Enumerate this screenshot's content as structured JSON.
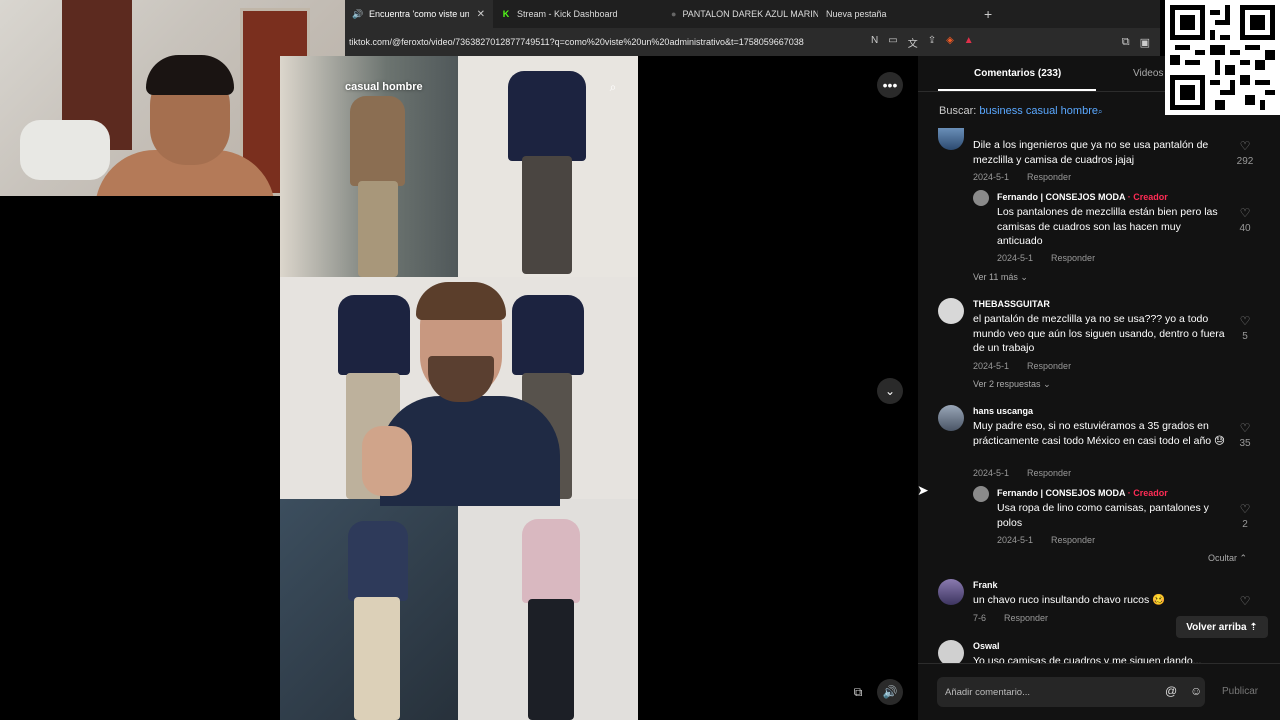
{
  "browser": {
    "tabs": [
      {
        "label": "Encuentra 'como viste un adm",
        "icon": "speaker-icon",
        "active": true
      },
      {
        "label": "Stream - Kick Dashboard",
        "icon": "kick-icon",
        "active": false
      },
      {
        "label": "PANTALON DAREK AZUL MARINO",
        "icon": "shop-icon",
        "active": false
      },
      {
        "label": "Nueva pestaña",
        "icon": "blank-icon",
        "active": false
      }
    ],
    "new_tab": "+",
    "url": "tiktok.com/@feroxto/video/7363827012877749511?q=como%20viste%20un%20administrativo&t=1758059667038"
  },
  "video": {
    "search_text": "casual hombre",
    "more_label": "•••"
  },
  "panel": {
    "tab_comments": "Comentarios (233)",
    "tab_videos": "Videos",
    "search_prefix": "Buscar:",
    "search_query": "business casual hombre",
    "comments": [
      {
        "author": "",
        "text": "Dile a los ingenieros que ya no se usa pantalón de mezclilla y camisa de cuadros jajaj",
        "date": "2024-5-1",
        "reply": "Responder",
        "likes": "292"
      },
      {
        "author": "Fernando | CONSEJOS MODA",
        "creator": "· Creador",
        "text": "Los pantalones de mezclilla están bien pero las camisas de cuadros son las hacen muy anticuado",
        "date": "2024-5-1",
        "reply": "Responder",
        "likes": "40"
      },
      {
        "author": "THEBASSGUITAR",
        "text": "el pantalón de mezclilla ya no se usa??? yo a todo mundo veo que aún los siguen usando, dentro o fuera de un trabajo",
        "date": "2024-5-1",
        "reply": "Responder",
        "likes": "5"
      },
      {
        "author": "hans uscanga",
        "text": "Muy padre eso, si no estuviéramos a 35 grados en prácticamente casi todo México en casi todo el año 😓",
        "date": "2024-5-1",
        "reply": "Responder",
        "likes": "35"
      },
      {
        "author": "Fernando | CONSEJOS MODA",
        "creator": "· Creador",
        "text": "Usa ropa de lino como camisas, pantalones y polos",
        "date": "2024-5-1",
        "reply": "Responder",
        "likes": "2"
      },
      {
        "author": "Frank",
        "text": "un chavo ruco insultando chavo rucos 🥴",
        "date": "7-6",
        "reply": "Responder",
        "likes": ""
      },
      {
        "author": "Oswal",
        "text": "Yo uso camisas de cuadros y me siguen dando...",
        "date": "",
        "reply": "",
        "likes": ""
      }
    ],
    "more_replies_1": "Ver 11 más",
    "more_replies_2": "Ver 2 respuestas",
    "hide": "Ocultar",
    "back_to_top": "Volver arriba",
    "composer_placeholder": "Añadir comentario...",
    "publish": "Publicar"
  }
}
